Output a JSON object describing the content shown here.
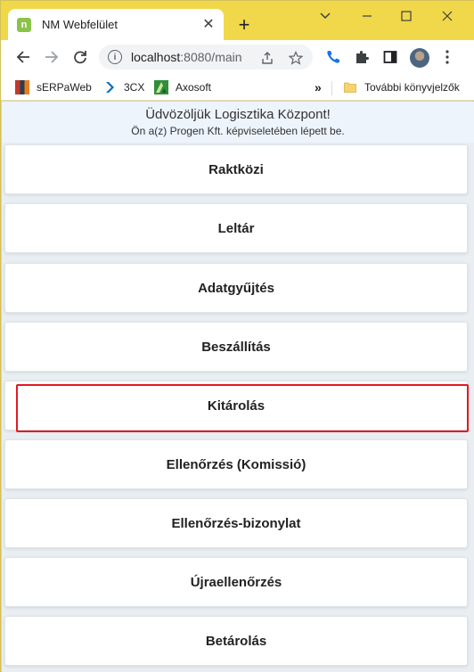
{
  "browser": {
    "tab_title": "NM Webfelület",
    "tab_favicon_letter": "n",
    "url_host": "localhost",
    "url_rest": ":8080/main",
    "new_tab_glyph": "+",
    "accent_color": "#f0d84a"
  },
  "bookmarks": {
    "items": [
      {
        "label": "sERPaWeb",
        "icon": "serpaweb-icon"
      },
      {
        "label": "3CX",
        "icon": "3cx-icon"
      },
      {
        "label": "Axosoft",
        "icon": "axosoft-icon"
      }
    ],
    "overflow_glyph": "»",
    "other_label": "További könyvjelzők"
  },
  "header": {
    "welcome": "Üdvözöljük Logisztika Központ!",
    "subtitle": "Ön a(z) Progen Kft. képviseletében lépett be."
  },
  "menu": {
    "items": [
      {
        "label": "Raktközi",
        "highlighted": false
      },
      {
        "label": "Leltár",
        "highlighted": false
      },
      {
        "label": "Adatgyűjtés",
        "highlighted": false
      },
      {
        "label": "Beszállítás",
        "highlighted": false
      },
      {
        "label": "Kitárolás",
        "highlighted": true
      },
      {
        "label": "Ellenőrzés (Komissió)",
        "highlighted": false
      },
      {
        "label": "Ellenőrzés-bizonylat",
        "highlighted": false
      },
      {
        "label": "Újraellenőrzés",
        "highlighted": false
      },
      {
        "label": "Betárolás",
        "highlighted": false
      }
    ],
    "highlight_color": "#e11b22"
  }
}
